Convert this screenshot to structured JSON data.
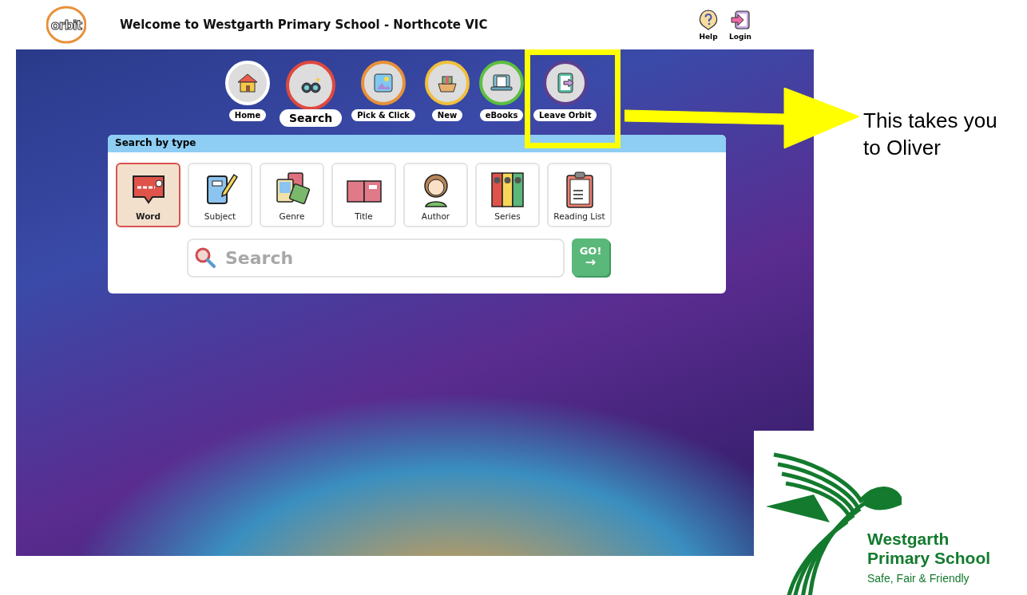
{
  "header": {
    "logo_text": "orbit",
    "title": "Welcome to Westgarth Primary School - Northcote VIC",
    "actions": [
      {
        "label": "Help",
        "kind": "help"
      },
      {
        "label": "Login",
        "kind": "login"
      }
    ]
  },
  "nav": [
    {
      "label": "Home",
      "color": "#ffffff",
      "selected": false,
      "kind": "home"
    },
    {
      "label": "Search",
      "color": "#e0483e",
      "selected": true,
      "kind": "search"
    },
    {
      "label": "Pick & Click",
      "color": "#e8913a",
      "selected": false,
      "kind": "picture"
    },
    {
      "label": "New",
      "color": "#f0c03c",
      "selected": false,
      "kind": "gift"
    },
    {
      "label": "eBooks",
      "color": "#5bbf3f",
      "selected": false,
      "kind": "ebook"
    },
    {
      "label": "Leave Orbit",
      "color": "#5b3f8f",
      "selected": false,
      "kind": "exit"
    }
  ],
  "search_panel": {
    "heading": "Search by type",
    "types": [
      {
        "label": "Word",
        "selected": true,
        "kind": "word"
      },
      {
        "label": "Subject",
        "selected": false,
        "kind": "subject"
      },
      {
        "label": "Genre",
        "selected": false,
        "kind": "genre"
      },
      {
        "label": "Title",
        "selected": false,
        "kind": "title"
      },
      {
        "label": "Author",
        "selected": false,
        "kind": "author"
      },
      {
        "label": "Series",
        "selected": false,
        "kind": "series"
      },
      {
        "label": "Reading List",
        "selected": false,
        "kind": "list"
      }
    ],
    "search": {
      "placeholder": "Search"
    },
    "go_button": {
      "label": "GO!",
      "arrow": "→"
    }
  },
  "annotation": {
    "text": "This takes you to Oliver"
  },
  "school_logo": {
    "name_line_1": "Westgarth",
    "name_line_2": "Primary School",
    "motto": "Safe, Fair & Friendly"
  }
}
